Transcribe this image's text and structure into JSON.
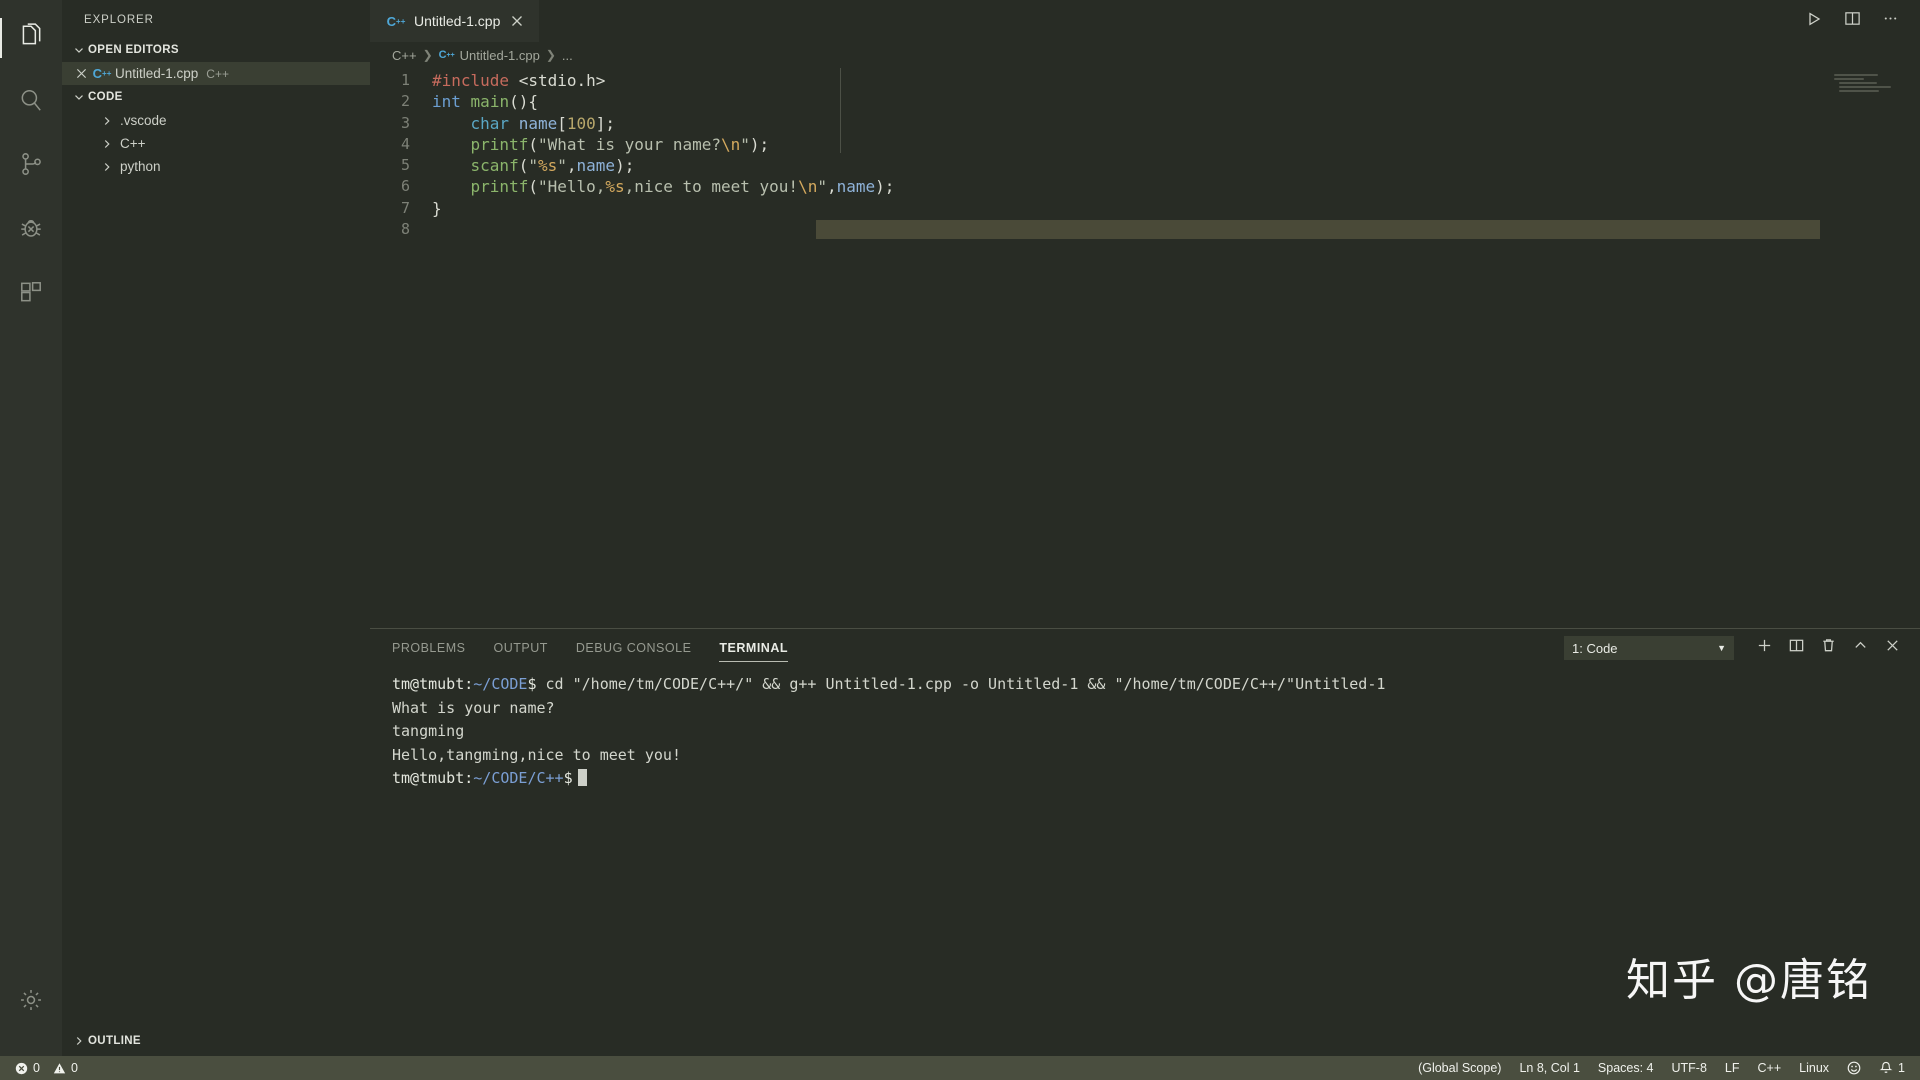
{
  "activitybar": {
    "items": [
      {
        "name": "explorer",
        "icon": "files-icon",
        "active": true
      },
      {
        "name": "search",
        "icon": "search-icon",
        "active": false
      },
      {
        "name": "source-control",
        "icon": "source-control-icon",
        "active": false
      },
      {
        "name": "run-debug",
        "icon": "debug-icon",
        "active": false
      },
      {
        "name": "extensions",
        "icon": "extensions-icon",
        "active": false
      }
    ],
    "manage_icon": "gear-icon"
  },
  "sidebar": {
    "title": "EXPLORER",
    "open_editors": {
      "label": "OPEN EDITORS",
      "items": [
        {
          "filename": "Untitled-1.cpp",
          "tag": "C++",
          "selected": true,
          "close_icon": "close-icon",
          "file_icon": "cpp-file-icon"
        }
      ]
    },
    "folder": {
      "label": "CODE",
      "items": [
        {
          "label": ".vscode",
          "expanded": false
        },
        {
          "label": "C++",
          "expanded": false
        },
        {
          "label": "python",
          "expanded": false
        }
      ]
    },
    "outline_label": "OUTLINE"
  },
  "editor": {
    "tabs": [
      {
        "label": "Untitled-1.cpp",
        "active": true,
        "icon": "cpp-file-icon",
        "close_icon": "close-icon"
      }
    ],
    "actions": [
      {
        "name": "run-code-button",
        "icon": "play-icon"
      },
      {
        "name": "split-editor-button",
        "icon": "split-editor-icon"
      },
      {
        "name": "more-actions-button",
        "icon": "ellipsis-icon"
      }
    ],
    "breadcrumb": [
      "C++",
      "Untitled-1.cpp",
      "..."
    ],
    "lines": [
      {
        "n": "1",
        "tokens": [
          {
            "t": "#include",
            "c": "t-pre"
          },
          {
            "t": " ",
            "c": "t-plain"
          },
          {
            "t": "<stdio.h>",
            "c": "t-inc"
          }
        ]
      },
      {
        "n": "2",
        "tokens": [
          {
            "t": "int",
            "c": "t-kw"
          },
          {
            "t": " ",
            "c": "t-plain"
          },
          {
            "t": "main",
            "c": "t-fn"
          },
          {
            "t": "(){",
            "c": "t-punc"
          }
        ]
      },
      {
        "n": "3",
        "tokens": [
          {
            "t": "    ",
            "c": "t-plain"
          },
          {
            "t": "char",
            "c": "t-type"
          },
          {
            "t": " ",
            "c": "t-plain"
          },
          {
            "t": "name",
            "c": "t-var"
          },
          {
            "t": "[",
            "c": "t-punc"
          },
          {
            "t": "100",
            "c": "t-num"
          },
          {
            "t": "];",
            "c": "t-punc"
          }
        ]
      },
      {
        "n": "4",
        "tokens": [
          {
            "t": "    ",
            "c": "t-plain"
          },
          {
            "t": "printf",
            "c": "t-fn"
          },
          {
            "t": "(",
            "c": "t-punc"
          },
          {
            "t": "\"What is your name?",
            "c": "t-str"
          },
          {
            "t": "\\n",
            "c": "t-esc"
          },
          {
            "t": "\"",
            "c": "t-str"
          },
          {
            "t": ");",
            "c": "t-punc"
          }
        ]
      },
      {
        "n": "5",
        "tokens": [
          {
            "t": "    ",
            "c": "t-plain"
          },
          {
            "t": "scanf",
            "c": "t-fn"
          },
          {
            "t": "(",
            "c": "t-punc"
          },
          {
            "t": "\"",
            "c": "t-str"
          },
          {
            "t": "%s",
            "c": "t-fmt"
          },
          {
            "t": "\"",
            "c": "t-str"
          },
          {
            "t": ",",
            "c": "t-punc"
          },
          {
            "t": "name",
            "c": "t-var"
          },
          {
            "t": ");",
            "c": "t-punc"
          }
        ]
      },
      {
        "n": "6",
        "tokens": [
          {
            "t": "    ",
            "c": "t-plain"
          },
          {
            "t": "printf",
            "c": "t-fn"
          },
          {
            "t": "(",
            "c": "t-punc"
          },
          {
            "t": "\"Hello,",
            "c": "t-str"
          },
          {
            "t": "%s",
            "c": "t-fmt"
          },
          {
            "t": ",nice to meet you!",
            "c": "t-str"
          },
          {
            "t": "\\n",
            "c": "t-esc"
          },
          {
            "t": "\"",
            "c": "t-str"
          },
          {
            "t": ",",
            "c": "t-punc"
          },
          {
            "t": "name",
            "c": "t-var"
          },
          {
            "t": ");",
            "c": "t-punc"
          }
        ]
      },
      {
        "n": "7",
        "tokens": [
          {
            "t": "}",
            "c": "t-punc"
          }
        ]
      },
      {
        "n": "8",
        "tokens": []
      }
    ]
  },
  "panel": {
    "tabs": [
      {
        "label": "PROBLEMS",
        "active": false
      },
      {
        "label": "OUTPUT",
        "active": false
      },
      {
        "label": "DEBUG CONSOLE",
        "active": false
      },
      {
        "label": "TERMINAL",
        "active": true
      }
    ],
    "terminal_selector": "1: Code",
    "actions": [
      {
        "name": "new-terminal-button",
        "icon": "plus-icon"
      },
      {
        "name": "split-terminal-button",
        "icon": "split-icon"
      },
      {
        "name": "kill-terminal-button",
        "icon": "trash-icon"
      },
      {
        "name": "maximize-panel-button",
        "icon": "chevron-up-icon"
      },
      {
        "name": "close-panel-button",
        "icon": "close-icon"
      }
    ],
    "terminal_lines": [
      {
        "type": "prompt",
        "user": "tm@tmubt:",
        "path": "~/CODE",
        "dollar": "$",
        "command": " cd \"/home/tm/CODE/C++/\" && g++ Untitled-1.cpp -o Untitled-1 && \"/home/tm/CODE/C++/\"Untitled-1"
      },
      {
        "type": "output",
        "text": "What is your name?"
      },
      {
        "type": "output",
        "text": "tangming"
      },
      {
        "type": "output",
        "text": "Hello,tangming,nice to meet you!"
      },
      {
        "type": "prompt",
        "user": "tm@tmubt:",
        "path": "~/CODE/C++",
        "dollar": "$",
        "command": "",
        "cursor": true
      }
    ]
  },
  "statusbar": {
    "errors": "0",
    "warnings": "0",
    "scope": "(Global Scope)",
    "position": "Ln 8, Col 1",
    "indent": "Spaces: 4",
    "encoding": "UTF-8",
    "eol": "LF",
    "language": "C++",
    "platform": "Linux",
    "notifications": "1"
  },
  "watermark": "知乎 @唐铭"
}
